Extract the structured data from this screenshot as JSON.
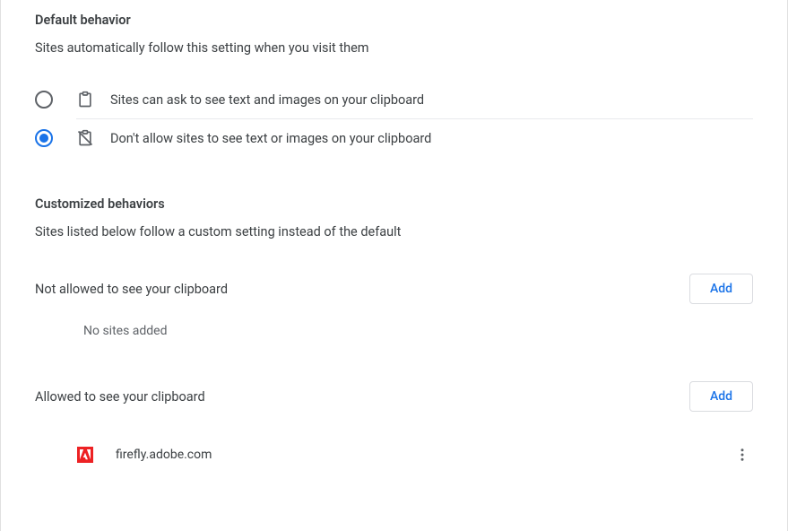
{
  "default_behavior": {
    "title": "Default behavior",
    "description": "Sites automatically follow this setting when you visit them",
    "options": [
      {
        "label": "Sites can ask to see text and images on your clipboard",
        "selected": false
      },
      {
        "label": "Don't allow sites to see text or images on your clipboard",
        "selected": true
      }
    ]
  },
  "customized": {
    "title": "Customized behaviors",
    "description": "Sites listed below follow a custom setting instead of the default"
  },
  "blocked": {
    "title": "Not allowed to see your clipboard",
    "add_label": "Add",
    "empty": "No sites added"
  },
  "allowed": {
    "title": "Allowed to see your clipboard",
    "add_label": "Add",
    "sites": [
      {
        "name": "firefly.adobe.com"
      }
    ]
  }
}
